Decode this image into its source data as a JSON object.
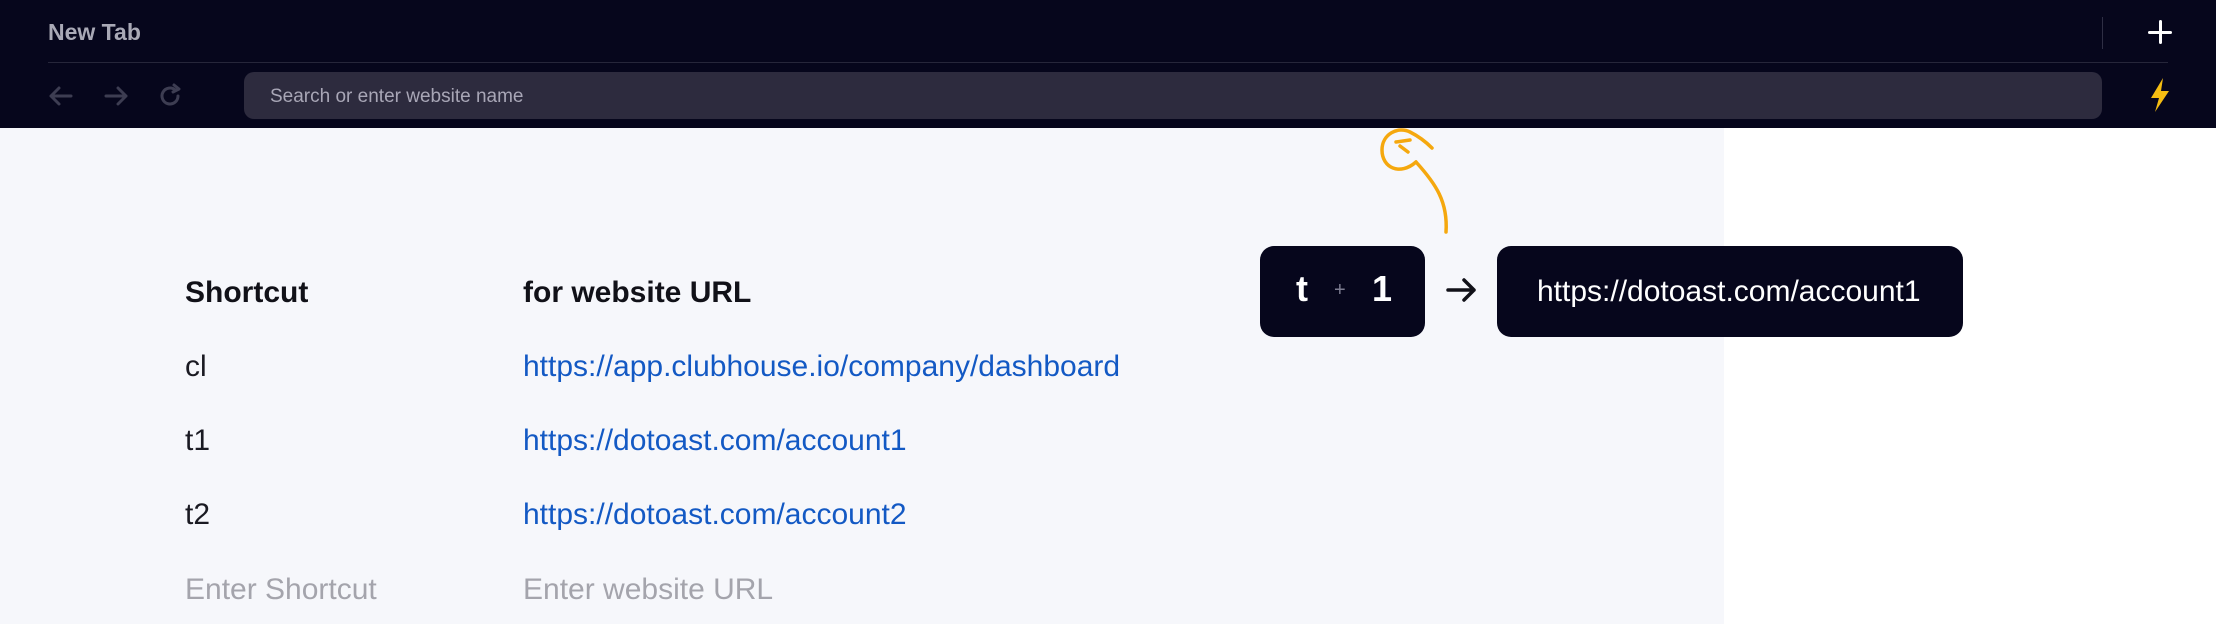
{
  "browser": {
    "tab_title": "New Tab",
    "address_placeholder": "Search or enter website name",
    "icons": {
      "new_tab": "plus-icon",
      "back": "arrow-left-icon",
      "forward": "arrow-right-icon",
      "reload": "reload-icon",
      "extension": "lightning-bolt-icon"
    },
    "colors": {
      "chrome": "#06061c",
      "address_bar": "#2d2b3e",
      "bolt": "#f5bd12"
    }
  },
  "shortcuts_table": {
    "headers": {
      "shortcut": "Shortcut",
      "url": "for website URL"
    },
    "rows": [
      {
        "shortcut": "cl",
        "url": "https://app.clubhouse.io/company/dashboard"
      },
      {
        "shortcut": "t1",
        "url": "https://dotoast.com/account1"
      },
      {
        "shortcut": "t2",
        "url": "https://dotoast.com/account2"
      }
    ],
    "new_row": {
      "shortcut_placeholder": "Enter Shortcut",
      "url_placeholder": "Enter website URL"
    },
    "colors": {
      "link": "#1359c4",
      "placeholder": "#a4a4ac"
    }
  },
  "demo": {
    "key_first": "t",
    "key_plus": "+",
    "key_second": "1",
    "arrow_icon": "arrow-right-icon",
    "result_url": "https://dotoast.com/account1",
    "pointer_icon": "curved-arrow-up-icon",
    "colors": {
      "chip": "#06061c",
      "pointer": "#f5a80e"
    }
  }
}
